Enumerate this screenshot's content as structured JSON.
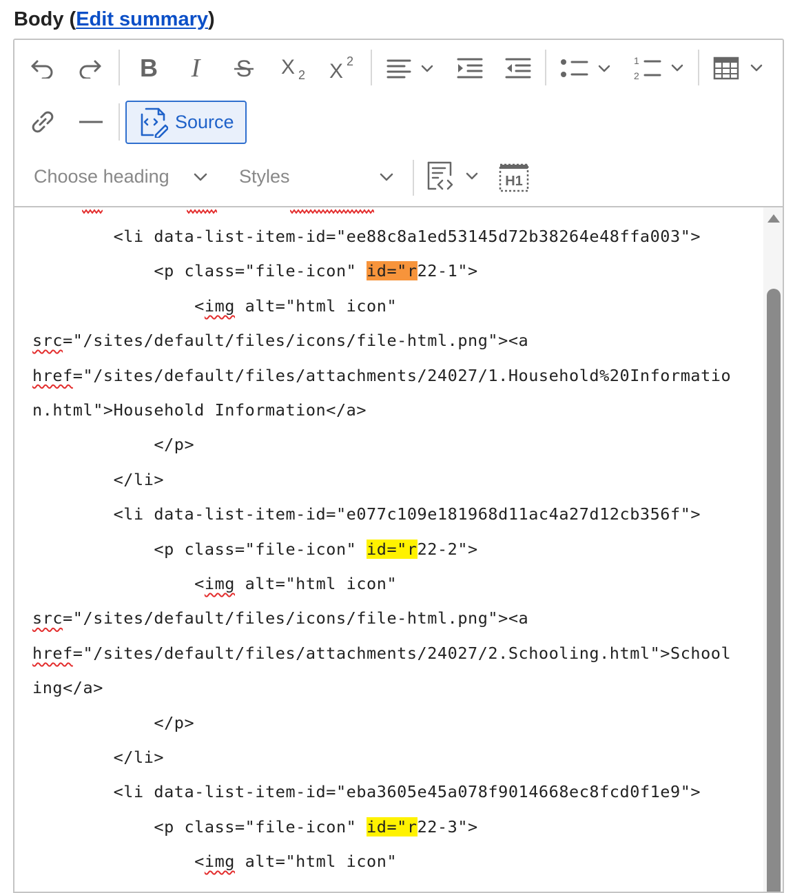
{
  "field": {
    "label": "Body",
    "open_paren": " (",
    "link": "Edit summary",
    "close_paren": ")"
  },
  "toolbar": {
    "row1": [
      "undo",
      "redo",
      "bold",
      "italic",
      "strikethrough",
      "subscript",
      "superscript",
      "alignment",
      "outdent",
      "indent",
      "bulleted-list",
      "numbered-list",
      "insert-table"
    ],
    "row2": [
      "link",
      "horizontal-line"
    ],
    "source_label": "Source",
    "heading_placeholder": "Choose heading",
    "styles_placeholder": "Styles",
    "row3_icons": [
      "code-block",
      "heading-1-marker"
    ]
  },
  "colors": {
    "accent": "#1f62c9",
    "link": "#0b4fc7",
    "match_current": "#f7943b",
    "match": "#fff200",
    "spell_error": "#e32d2d"
  },
  "source_lines": [
    {
      "indent": "        ",
      "parts": [
        {
          "t": "<li data-list-item-id=\"ee88c8a1ed53145d72b38264e48ffa003\">"
        }
      ]
    },
    {
      "indent": "            ",
      "parts": [
        {
          "t": "<p class=\"file-icon\" "
        },
        {
          "t": "id=\"r",
          "hl": "current"
        },
        {
          "t": "22-1\">"
        }
      ]
    },
    {
      "indent": "                ",
      "parts": [
        {
          "t": "<"
        },
        {
          "t": "img",
          "sq": true
        },
        {
          "t": " alt=\"html icon\""
        }
      ]
    },
    {
      "indent": "",
      "parts": [
        {
          "t": "src",
          "sq": true
        },
        {
          "t": "=\"/sites/default/files/icons/file-html.png\"><a"
        }
      ]
    },
    {
      "indent": "",
      "parts": [
        {
          "t": "href",
          "sq": true
        },
        {
          "t": "=\"/sites/default/files/attachments/24027/1.Household%20Informatio"
        }
      ]
    },
    {
      "indent": "",
      "parts": [
        {
          "t": "n.html\">Household Information</a>"
        }
      ]
    },
    {
      "indent": "            ",
      "parts": [
        {
          "t": "</p>"
        }
      ]
    },
    {
      "indent": "        ",
      "parts": [
        {
          "t": "</li>"
        }
      ]
    },
    {
      "indent": "        ",
      "parts": [
        {
          "t": "<li data-list-item-id=\"e077c109e181968d11ac4a27d12cb356f\">"
        }
      ]
    },
    {
      "indent": "            ",
      "parts": [
        {
          "t": "<p class=\"file-icon\" "
        },
        {
          "t": "id=\"r",
          "hl": "match"
        },
        {
          "t": "22-2\">"
        }
      ]
    },
    {
      "indent": "                ",
      "parts": [
        {
          "t": "<"
        },
        {
          "t": "img",
          "sq": true
        },
        {
          "t": " alt=\"html icon\""
        }
      ]
    },
    {
      "indent": "",
      "parts": [
        {
          "t": "src",
          "sq": true
        },
        {
          "t": "=\"/sites/default/files/icons/file-html.png\"><a"
        }
      ]
    },
    {
      "indent": "",
      "parts": [
        {
          "t": "href",
          "sq": true
        },
        {
          "t": "=\"/sites/default/files/attachments/24027/2.Schooling.html\">School"
        }
      ]
    },
    {
      "indent": "",
      "parts": [
        {
          "t": "ing</a>"
        }
      ]
    },
    {
      "indent": "            ",
      "parts": [
        {
          "t": "</p>"
        }
      ]
    },
    {
      "indent": "        ",
      "parts": [
        {
          "t": "</li>"
        }
      ]
    },
    {
      "indent": "        ",
      "parts": [
        {
          "t": "<li data-list-item-id=\"eba3605e45a078f9014668ec8fcd0f1e9\">"
        }
      ]
    },
    {
      "indent": "            ",
      "parts": [
        {
          "t": "<p class=\"file-icon\" "
        },
        {
          "t": "id=\"r",
          "hl": "match"
        },
        {
          "t": "22-3\">"
        }
      ]
    },
    {
      "indent": "                ",
      "parts": [
        {
          "t": "<"
        },
        {
          "t": "img",
          "sq": true
        },
        {
          "t": " alt=\"html icon\""
        }
      ]
    }
  ]
}
